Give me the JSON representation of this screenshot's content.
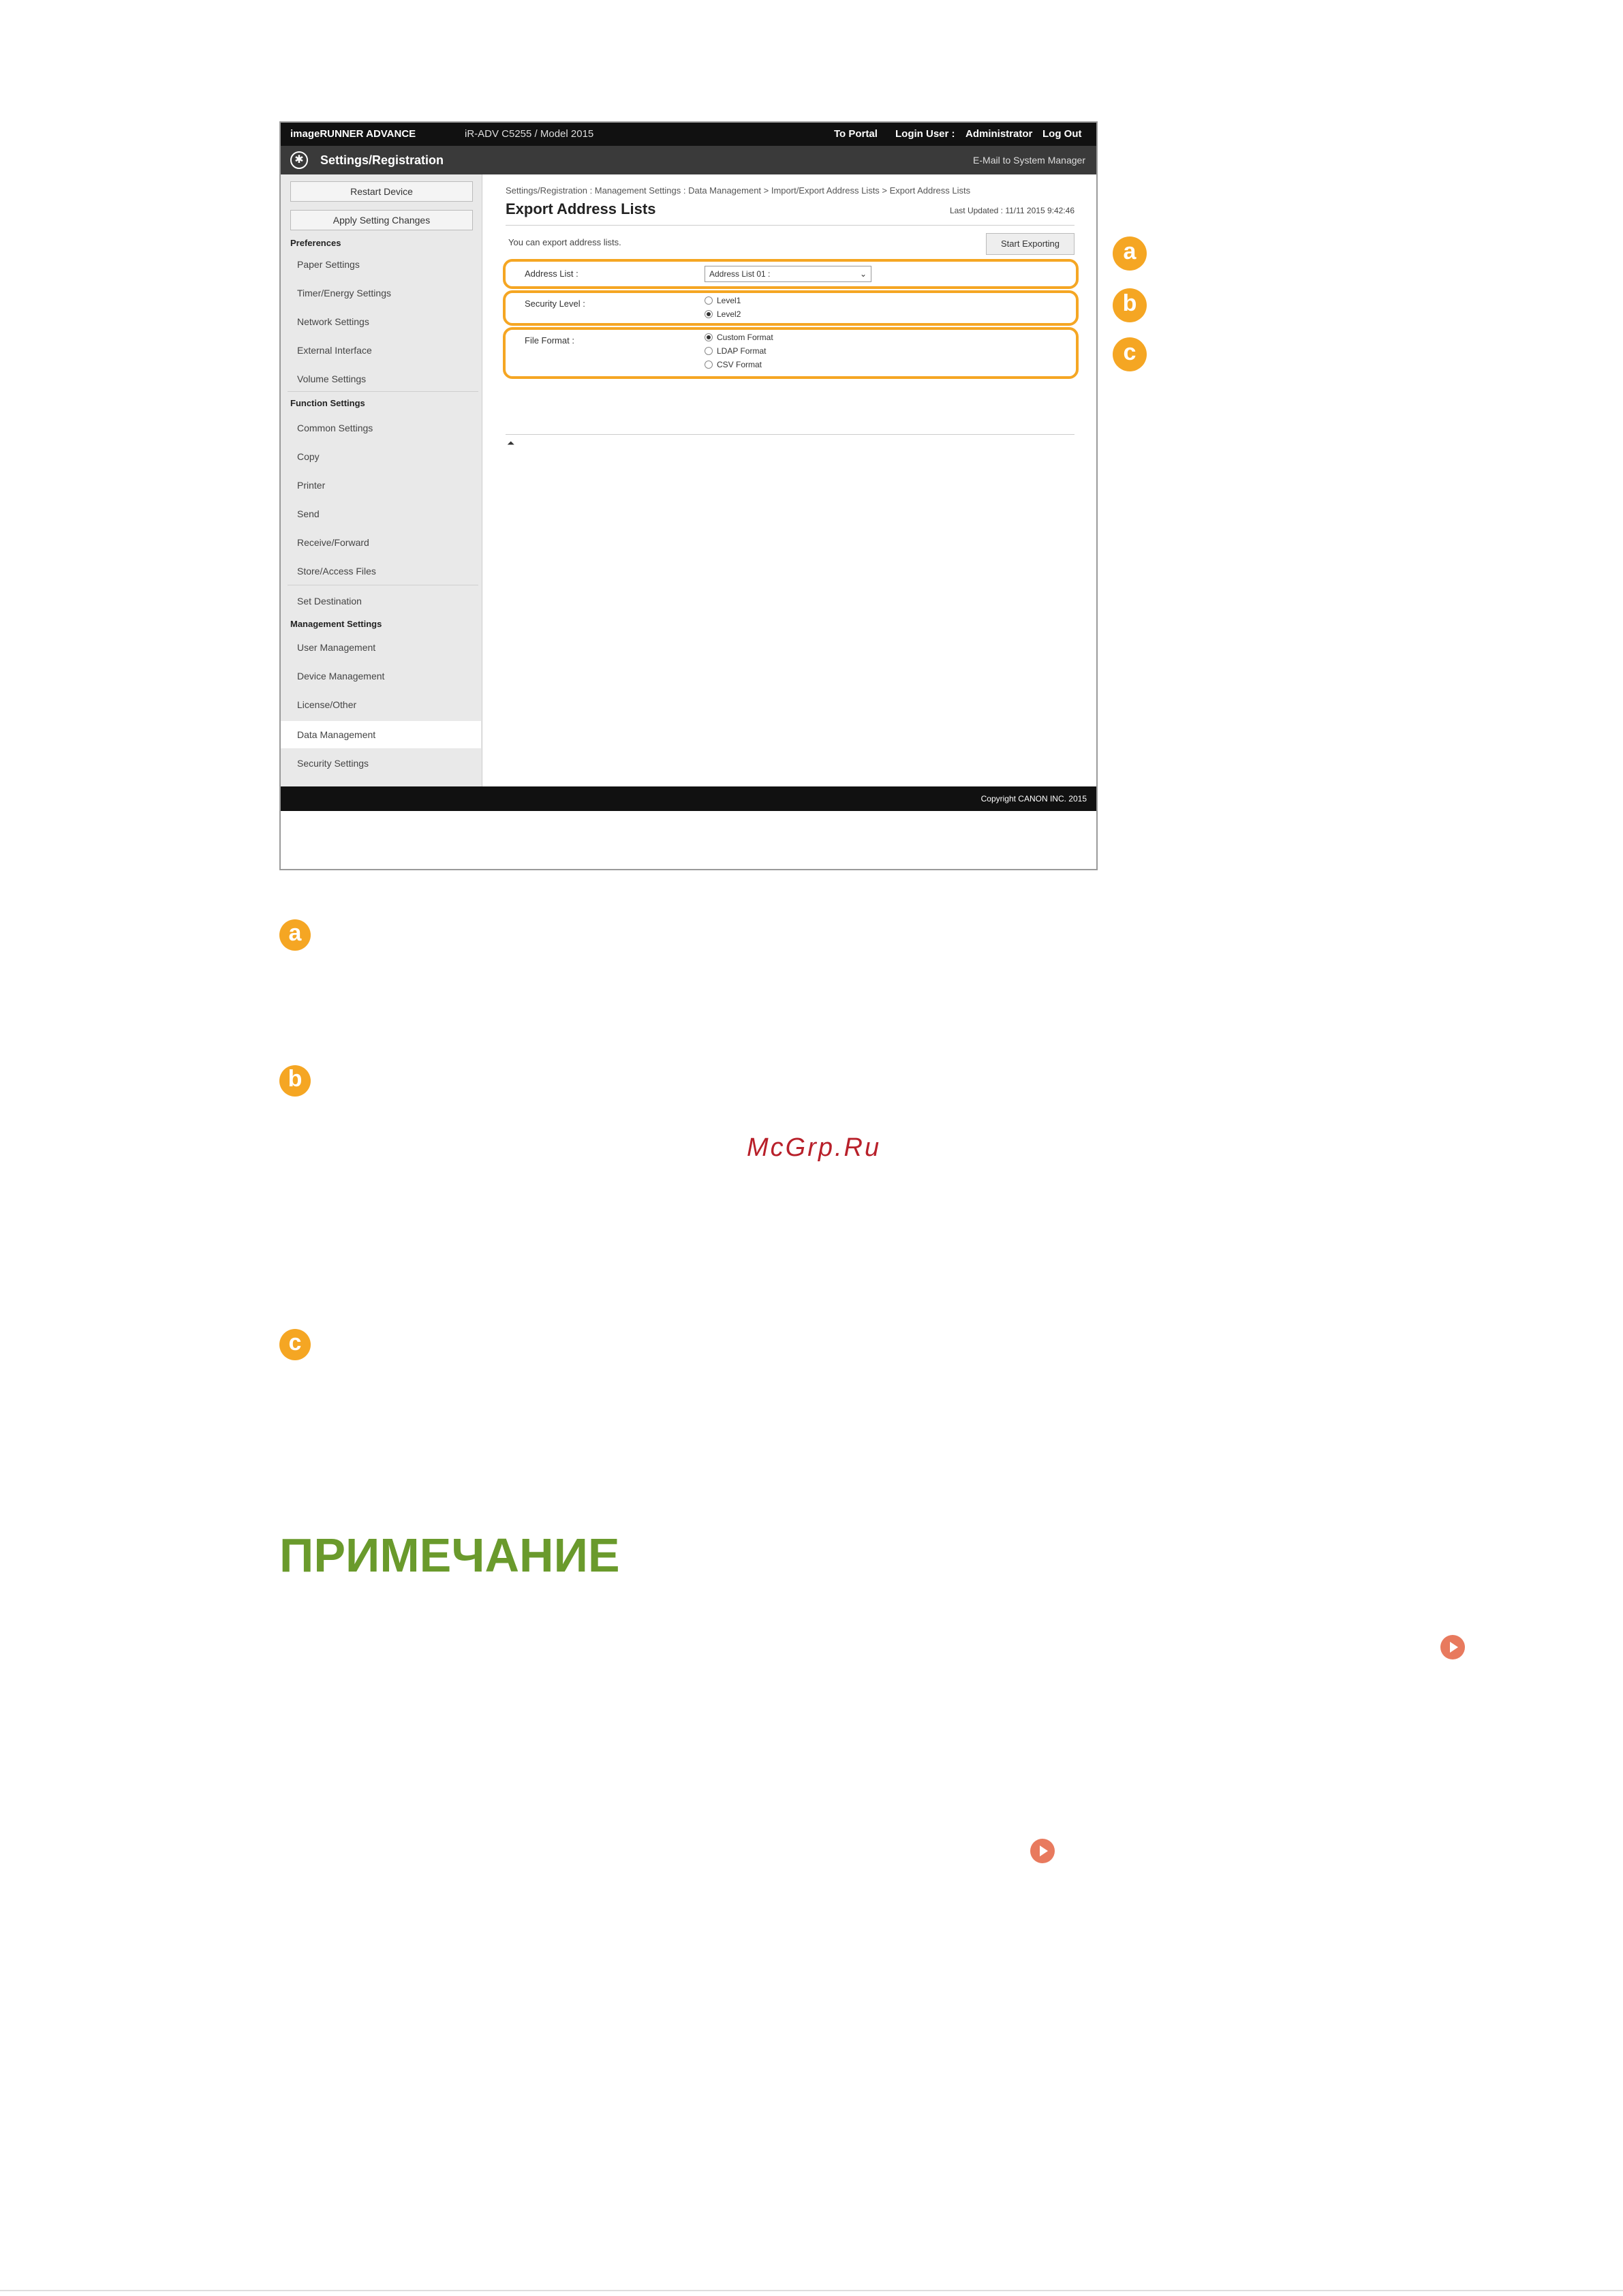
{
  "topbar": {
    "brand": "imageRUNNER ADVANCE",
    "model": "iR-ADV C5255 / Model 2015",
    "to_portal": "To Portal",
    "login_user_label": "Login User :",
    "user": "Administrator",
    "logout": "Log Out"
  },
  "titlebar": {
    "title": "Settings/Registration",
    "mail": "E-Mail to System Manager"
  },
  "sidebar": {
    "restart": "Restart Device",
    "apply": "Apply Setting Changes",
    "sections": [
      {
        "title": "Preferences",
        "items": [
          "Paper Settings",
          "Timer/Energy Settings",
          "Network Settings",
          "External Interface",
          "Volume Settings"
        ]
      },
      {
        "title": "Function Settings",
        "items": [
          "Common Settings",
          "Copy",
          "Printer",
          "Send",
          "Receive/Forward",
          "Store/Access Files",
          "Set Destination"
        ]
      },
      {
        "title": "Management Settings",
        "items": [
          "User Management",
          "Device Management",
          "License/Other",
          "Data Management",
          "Security Settings"
        ]
      }
    ]
  },
  "main": {
    "breadcrumb": "Settings/Registration : Management Settings : Data Management > Import/Export Address Lists > Export Address Lists",
    "title": "Export Address Lists",
    "last_updated": "Last Updated : 11/11 2015 9:42:46",
    "description": "You can export address lists.",
    "start_button": "Start Exporting",
    "address_list_label": "Address List :",
    "address_list_value": "Address List 01 :",
    "security_label": "Security Level :",
    "security_options": [
      "Level1",
      "Level2"
    ],
    "security_selected": "Level2",
    "format_label": "File Format :",
    "format_options": [
      "Custom Format",
      "LDAP Format",
      "CSV Format"
    ],
    "format_selected": "Custom Format",
    "top_icon": "go-to-top-icon"
  },
  "footer": {
    "copyright": "Copyright CANON INC. 2015"
  },
  "callouts": [
    "a",
    "b",
    "c"
  ],
  "watermark": "McGrp.Ru",
  "note_heading": "ПРИМЕЧАНИЕ",
  "colors": {
    "callout": "#f5a623",
    "note_heading": "#6a9a2c",
    "watermark": "#b8202a",
    "link_icon": "#e87a5e"
  }
}
